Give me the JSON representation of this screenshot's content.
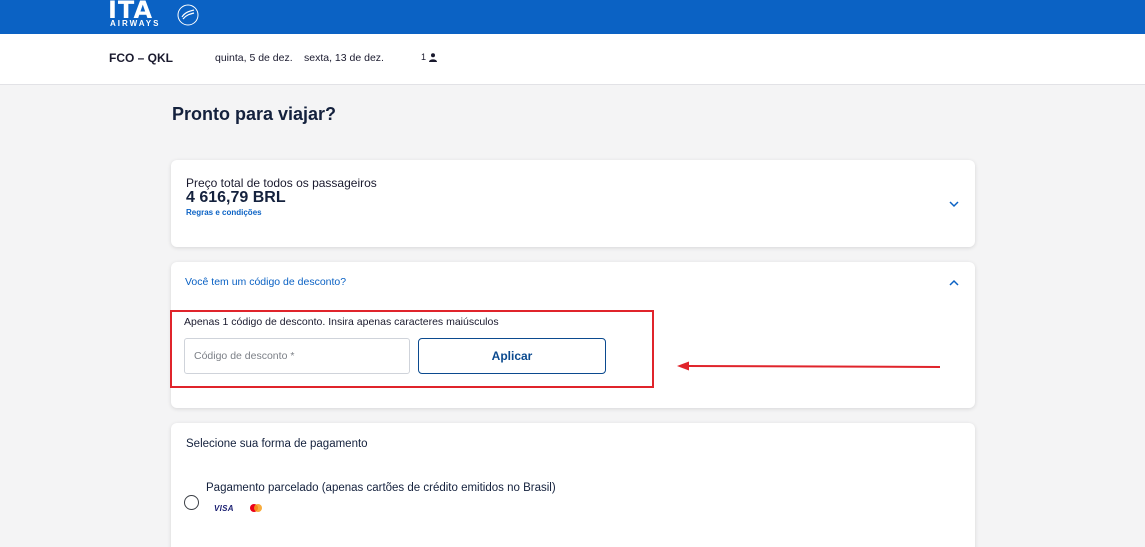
{
  "header": {
    "logo_text": "ITA",
    "logo_subtext": "AIRWAYS",
    "brand_color": "#0b62c4"
  },
  "search_summary": {
    "route": "FCO – QKL",
    "outbound_date": "quinta, 5 de dez.",
    "return_date": "sexta, 13 de dez.",
    "passengers": "1",
    "passenger_icon": "person-icon"
  },
  "page_title": "Pronto para viajar?",
  "price_card": {
    "label": "Preço total de todos os passageiros",
    "amount": "4 616,79 BRL",
    "rules_link": "Regras e condições",
    "toggle_icon": "chevron-down-icon"
  },
  "discount": {
    "title": "Você tem um código de desconto?",
    "toggle_icon": "chevron-up-icon",
    "hint": "Apenas 1 código de desconto. Insira apenas caracteres maiúsculos",
    "input_placeholder": "Código de desconto *",
    "input_value": "",
    "apply_label": "Aplicar"
  },
  "annotation": {
    "color": "#e0242b"
  },
  "payment": {
    "title": "Selecione sua forma de pagamento",
    "options": [
      {
        "label": "Pagamento parcelado (apenas cartões de crédito emitidos no Brasil)",
        "selected": false,
        "brands": [
          "VISA",
          "mastercard-icon"
        ]
      }
    ]
  }
}
